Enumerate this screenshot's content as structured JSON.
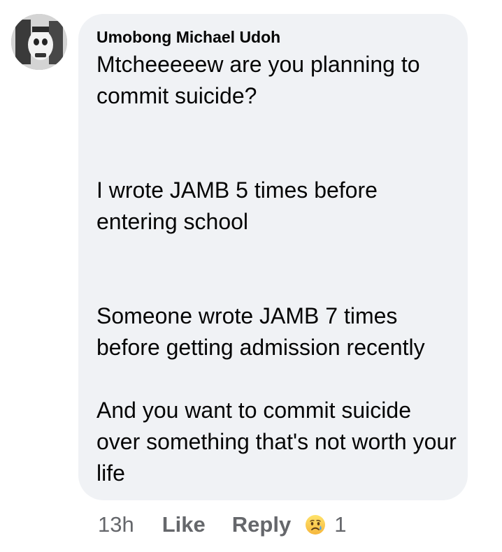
{
  "comment": {
    "author": "Umobong Michael Udoh",
    "paragraphs": [
      "Mtcheeeeew are you planning to commit suicide?",
      "I wrote JAMB 5 times before entering school",
      "Someone wrote JAMB 7 times before getting admission recently",
      "And you want to commit suicide over something that's not worth your life"
    ],
    "avatar_icon": "avatar-photo",
    "colors": {
      "bubble": "#f0f2f5",
      "text": "#050505",
      "secondary": "#65676b"
    }
  },
  "actions": {
    "timestamp": "13h",
    "like_label": "Like",
    "reply_label": "Reply",
    "reaction_icon": "sad-emoji-icon",
    "reaction_count": "1"
  }
}
